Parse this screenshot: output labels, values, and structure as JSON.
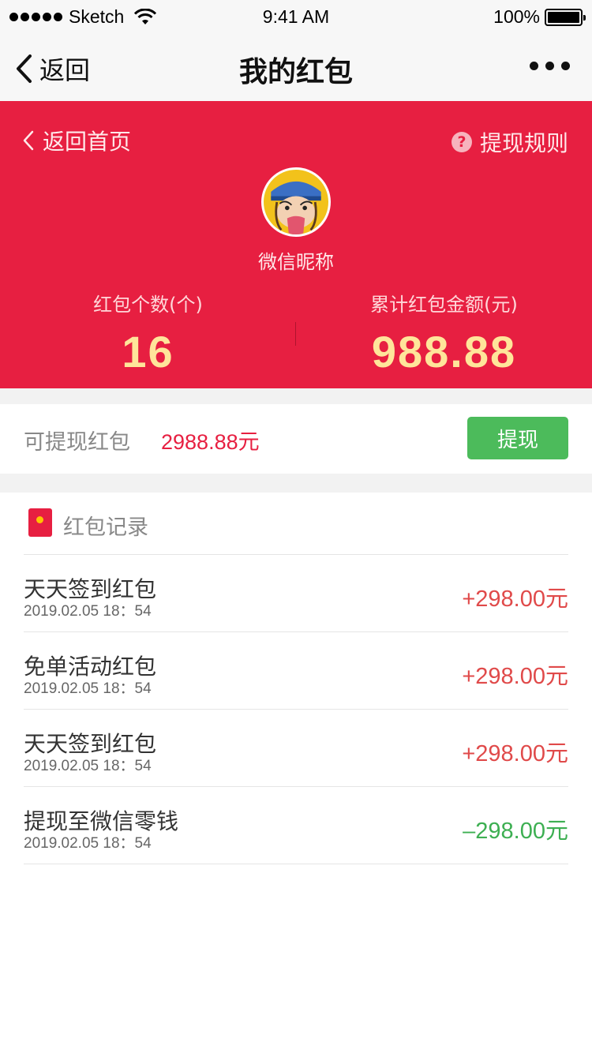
{
  "status_bar": {
    "carrier": "Sketch",
    "time": "9:41 AM",
    "battery": "100%"
  },
  "nav": {
    "back_label": "返回",
    "title": "我的红包"
  },
  "hero": {
    "back_label": "返回首页",
    "rules_label": "提现规则",
    "help_glyph": "?",
    "nickname": "微信昵称",
    "count_label": "红包个数(个)",
    "count_value": "16",
    "total_label": "累计红包金额(元)",
    "total_value": "988.88",
    "color": "#e71f41",
    "value_color": "#ffe59a"
  },
  "withdraw": {
    "label": "可提现红包",
    "amount": "2988.88元",
    "button_label": "提现",
    "button_color": "#4cbb5b"
  },
  "records": {
    "title": "红包记录",
    "items": [
      {
        "title": "天天签到红包",
        "time": "2019.02.05 18：54",
        "amount": "+298.00元",
        "type": "income"
      },
      {
        "title": "免单活动红包",
        "time": "2019.02.05 18：54",
        "amount": "+298.00元",
        "type": "income"
      },
      {
        "title": "天天签到红包",
        "time": "2019.02.05 18：54",
        "amount": "+298.00元",
        "type": "income"
      },
      {
        "title": "提现至微信零钱",
        "time": "2019.02.05 18：54",
        "amount": "–298.00元",
        "type": "expense"
      }
    ],
    "income_color": "#e04a4a",
    "expense_color": "#3daf52"
  }
}
